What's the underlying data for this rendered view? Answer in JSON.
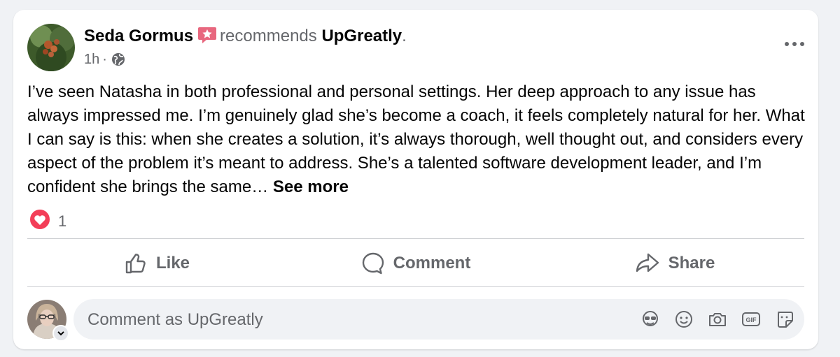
{
  "post": {
    "author_name": "Seda Gormus",
    "recommends_text": "recommends",
    "page_name": "UpGreatly",
    "period": ".",
    "time": "1h",
    "separator": "·",
    "body": "I’ve seen Natasha in both professional and personal settings. Her deep approach to any issue has always impressed me. I’m genuinely glad she’s become a coach,  it feels completely natural for her. What I can say is this: when she creates a solution, it’s always thorough, well thought out, and considers every aspect of the problem it’s meant to address. She’s a talented software development leader, and I’m confident she brings the same…",
    "see_more": "See more",
    "reaction_count": "1"
  },
  "actions": {
    "like": "Like",
    "comment": "Comment",
    "share": "Share"
  },
  "composer": {
    "placeholder": "Comment as UpGreatly"
  },
  "icons": {
    "recommend_badge": "star-badge-icon",
    "privacy": "globe-icon",
    "more": "more-options-icon",
    "reaction": "heart-reaction-icon",
    "like": "thumbs-up-icon",
    "comment": "speech-bubble-icon",
    "share": "share-arrow-icon",
    "avatar_menu": "chevron-down-icon",
    "tools": [
      "avatar-sticker-icon",
      "emoji-icon",
      "camera-icon",
      "gif-icon",
      "sticker-icon"
    ]
  },
  "colors": {
    "background": "#f0f2f5",
    "card": "#ffffff",
    "text_primary": "#050505",
    "text_secondary": "#65676b",
    "divider": "#ced0d4",
    "badge_pink": "#e8677e",
    "heart_red": "#f33e58"
  }
}
